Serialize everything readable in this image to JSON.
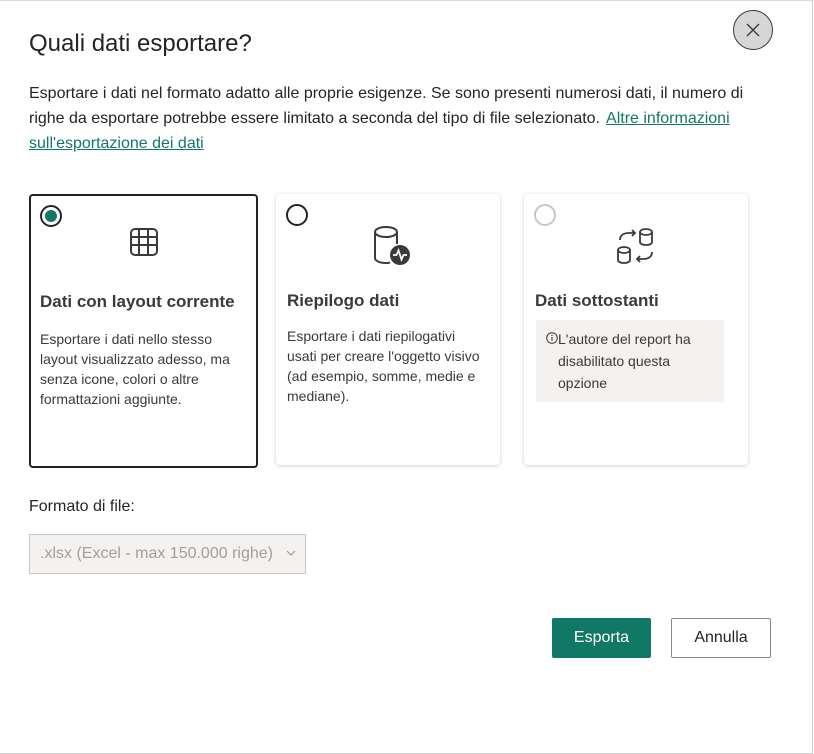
{
  "dialog": {
    "title": "Quali dati esportare?",
    "description": "Esportare i dati nel formato adatto alle proprie esigenze. Se sono presenti numerosi dati, il numero di righe da esportare potrebbe essere limitato a seconda del tipo di file selezionato.",
    "learn_more_link": "Altre informazioni sull'esportazione dei dati",
    "close_icon": "close-icon"
  },
  "options": [
    {
      "title": "Dati con layout corrente",
      "text": "Esportare i dati nello stesso layout visualizzato adesso, ma senza icone, colori o altre formattazioni aggiunte.",
      "icon": "table-icon",
      "selected": true
    },
    {
      "title": "Riepilogo dati",
      "text": "Esportare i dati riepilogativi usati per creare l'oggetto visivo (ad esempio, somme, medie e mediane).",
      "icon": "database-summary-icon",
      "selected": false
    },
    {
      "title": "Dati sottostanti",
      "note": "L'autore del report ha disabilitato questa opzione",
      "icon": "database-sync-icon",
      "disabled": true
    }
  ],
  "format": {
    "label": "Formato di file:",
    "value": ".xlsx (Excel - max 150.000 righe)"
  },
  "buttons": {
    "export": "Esporta",
    "cancel": "Annulla"
  },
  "colors": {
    "accent": "#117865",
    "text": "#252423"
  }
}
